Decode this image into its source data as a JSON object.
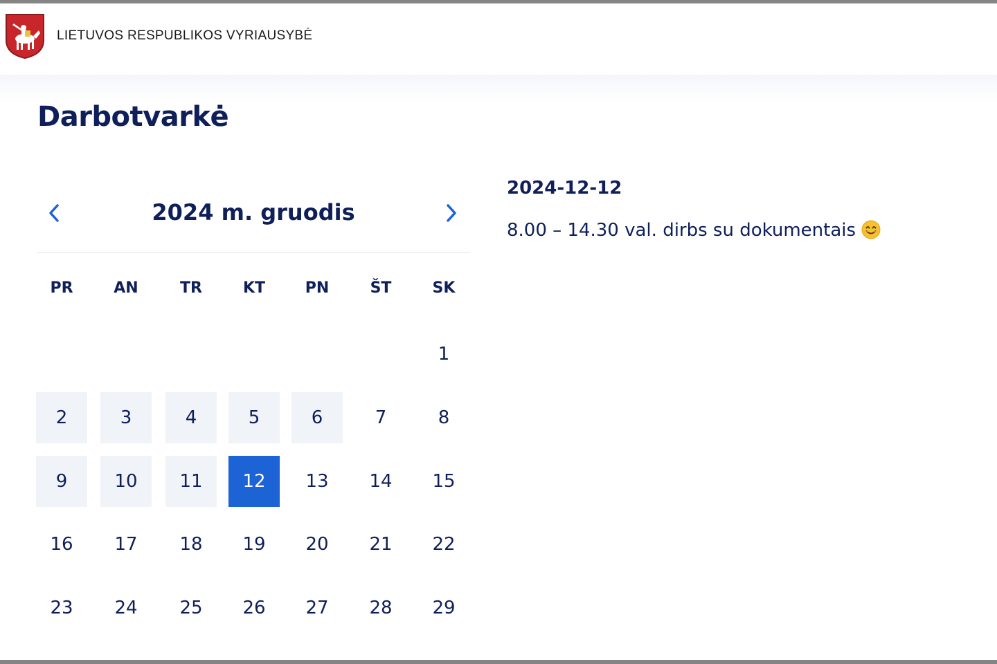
{
  "header": {
    "title": "LIETUVOS RESPUBLIKOS VYRIAUSYBĖ",
    "logo_icon": "lithuania-coat-of-arms-icon"
  },
  "page": {
    "title": "Darbotvarkė"
  },
  "calendar": {
    "month_label": "2024 m. gruodis",
    "prev_icon": "chevron-left-icon",
    "next_icon": "chevron-right-icon",
    "weekdays": [
      "PR",
      "AN",
      "TR",
      "KT",
      "PN",
      "ŠT",
      "SK"
    ],
    "first_day_column": 6,
    "visible_days": [
      1,
      2,
      3,
      4,
      5,
      6,
      7,
      8,
      9,
      10,
      11,
      12,
      13,
      14,
      15,
      16,
      17,
      18,
      19,
      20,
      21,
      22,
      23,
      24,
      25,
      26,
      27,
      28,
      29
    ],
    "days_with_events": [
      2,
      3,
      4,
      5,
      6,
      9,
      10,
      11
    ],
    "selected_day": 12,
    "colors": {
      "selected_bg": "#1c63d6",
      "event_bg": "#f0f3f7",
      "text": "#0f1f5a",
      "nav_arrow": "#1c63d6"
    }
  },
  "event": {
    "date": "2024-12-12",
    "text": "8.00 – 14.30 val. dirbs su dokumentais",
    "emoji_icon": "smiling-face-icon"
  }
}
